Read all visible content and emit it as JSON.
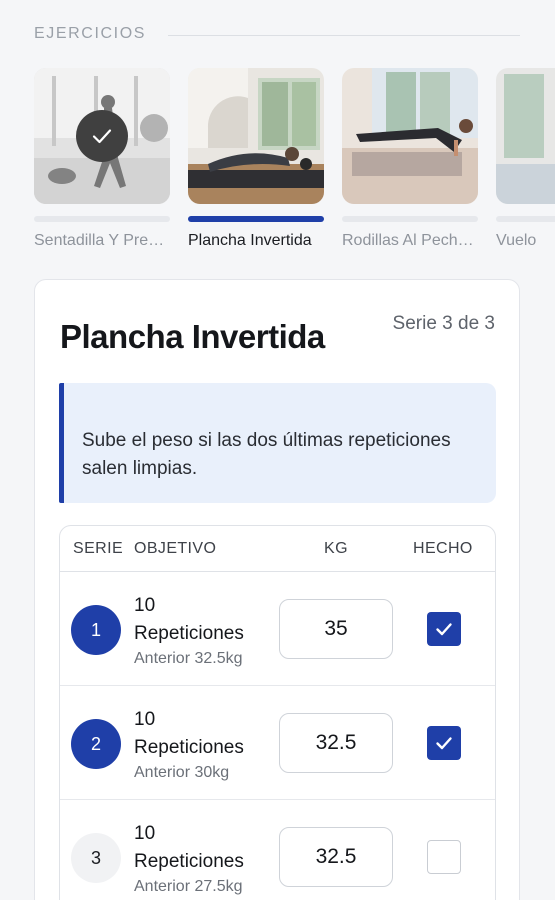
{
  "section": {
    "title": "EJERCICIOS"
  },
  "exercises": [
    {
      "label": "Sentadilla Y Pre…",
      "state": "completed",
      "icon": "check-icon"
    },
    {
      "label": "Plancha Invertida",
      "state": "active"
    },
    {
      "label": "Rodillas Al Pech…",
      "state": "upcoming"
    },
    {
      "label": "Vuelo",
      "state": "upcoming"
    }
  ],
  "card": {
    "title": "Plancha Invertida",
    "set_counter": "Serie 3 de 3",
    "tip": "Sube el peso si las dos últimas repeticiones salen limpias."
  },
  "table": {
    "headers": {
      "serie": "SERIE",
      "objetivo": "OBJETIVO",
      "kg": "KG",
      "hecho": "HECHO"
    },
    "rows": [
      {
        "num": "1",
        "reps": "10",
        "unit": "Repeticiones",
        "previous": "Anterior 32.5kg",
        "kg": "35",
        "done": true
      },
      {
        "num": "2",
        "reps": "10",
        "unit": "Repeticiones",
        "previous": "Anterior 30kg",
        "kg": "32.5",
        "done": true
      },
      {
        "num": "3",
        "reps": "10",
        "unit": "Repeticiones",
        "previous": "Anterior 27.5kg",
        "kg": "32.5",
        "done": false
      }
    ]
  },
  "colors": {
    "accent": "#1f3fa8",
    "tip_bg": "#e9f0fb",
    "muted_text": "#8e939b"
  }
}
